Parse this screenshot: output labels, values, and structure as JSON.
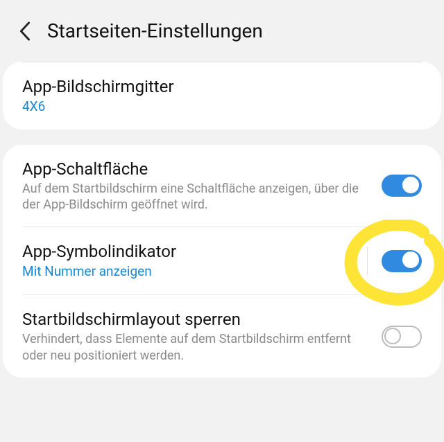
{
  "colors": {
    "accent": "#1788d3",
    "switch_on": "#2f8ae0",
    "highlight": "#ffe438"
  },
  "header": {
    "title": "Startseiten-Einstellungen"
  },
  "grid_card": {
    "title": "App-Bildschirmgitter",
    "value": "4X6"
  },
  "rows": {
    "app_button": {
      "title": "App-Schaltfläche",
      "desc": "Auf dem Startbildschirm eine Schaltfläche anzeigen, über die der App-Bildschirm geöffnet wird.",
      "on": true
    },
    "indicator": {
      "title": "App-Symbolindikator",
      "desc": "Mit Nummer anzeigen",
      "on": true
    },
    "lock_layout": {
      "title": "Startbildschirmlayout sperren",
      "desc": "Verhindert, dass Elemente auf dem Startbildschirm entfernt oder neu positioniert werden.",
      "on": false
    }
  }
}
